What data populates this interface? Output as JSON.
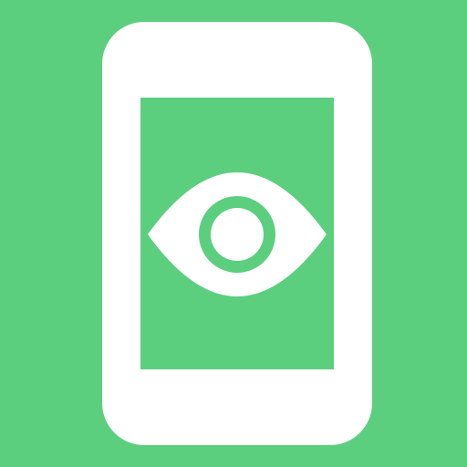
{
  "icon": {
    "name": "phone-eye-icon",
    "depicts": [
      "smartphone-icon",
      "eye-icon"
    ],
    "colors": {
      "background": "#5ccf7f",
      "foreground": "#ffffff"
    }
  }
}
